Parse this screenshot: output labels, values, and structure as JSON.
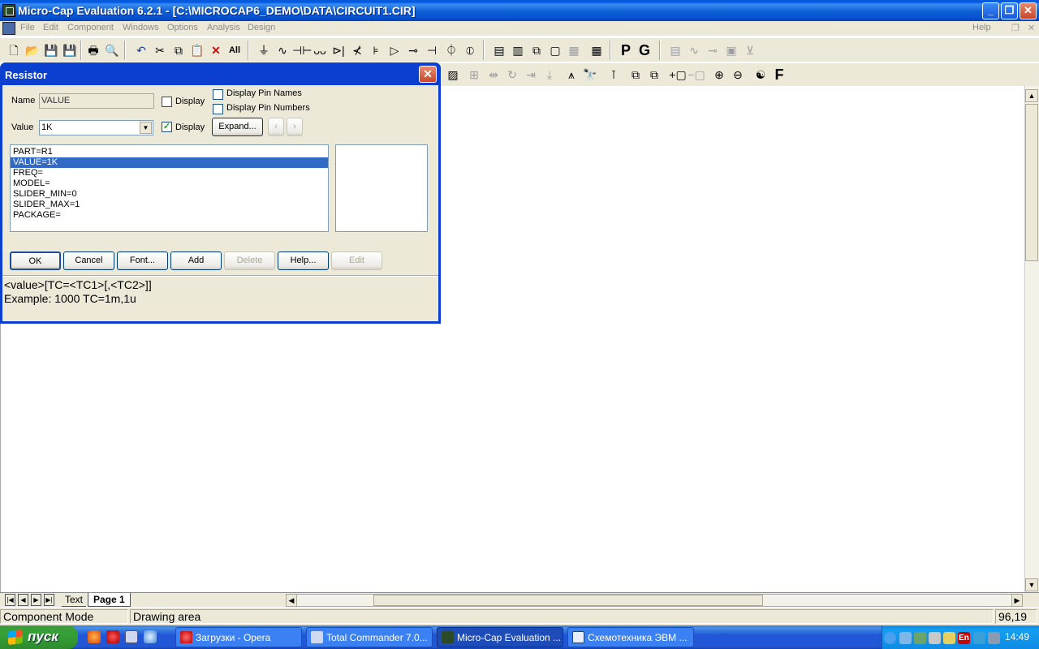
{
  "window": {
    "title": "Micro-Cap Evaluation 6.2.1 - [C:\\MICROCAP6_DEMO\\DATA\\CIRCUIT1.CIR]",
    "minimize": "_",
    "restore": "❐",
    "close": "✕"
  },
  "menu": {
    "items": [
      "File",
      "Edit",
      "Component",
      "Windows",
      "Options",
      "Analysis",
      "Design"
    ],
    "help": "Help",
    "mdi_restore": "❐",
    "mdi_close": "✕"
  },
  "toolbar1": {
    "print_labels": [
      "P",
      "G"
    ]
  },
  "toolbar2": {
    "font_label": "F"
  },
  "dialog": {
    "title": "Resistor",
    "close": "✕",
    "name_label": "Name",
    "name_value": "VALUE",
    "name_display_label": "Display",
    "name_display_checked": false,
    "display_pin_names_label": "Display Pin Names",
    "display_pin_names_checked": false,
    "display_pin_numbers_label": "Display Pin Numbers",
    "display_pin_numbers_checked": false,
    "value_label": "Value",
    "value_value": "1K",
    "value_display_label": "Display",
    "value_display_checked": true,
    "expand_label": "Expand...",
    "attributes": [
      "PART=R1",
      "VALUE=1K",
      "FREQ=",
      "MODEL=",
      "SLIDER_MIN=0",
      "SLIDER_MAX=1",
      "PACKAGE="
    ],
    "selected_attribute": "VALUE=1K",
    "buttons": {
      "ok": "OK",
      "cancel": "Cancel",
      "font": "Font...",
      "add": "Add",
      "delete": "Delete",
      "help": "Help...",
      "edit": "Edit"
    },
    "help_text_1": "<value>[TC=<TC1>[,<TC2>]]",
    "help_text_2": "Example: 1000 TC=1m,1u"
  },
  "tabs": {
    "text": "Text",
    "page1": "Page 1"
  },
  "status": {
    "mode": "Component Mode",
    "area": "Drawing area",
    "coords": "96,19"
  },
  "taskbar": {
    "start": "пуск",
    "tasks": [
      "Загрузки - Opera",
      "Total Commander 7.0...",
      "Micro-Cap Evaluation ...",
      "Схемотехника ЭВМ ..."
    ],
    "active_task": "Micro-Cap Evaluation ...",
    "lang": "En",
    "clock": "14:49"
  },
  "colors": {
    "xp_blue": "#0a5bd8",
    "selection": "#316ac5",
    "face": "#ece9d8"
  }
}
